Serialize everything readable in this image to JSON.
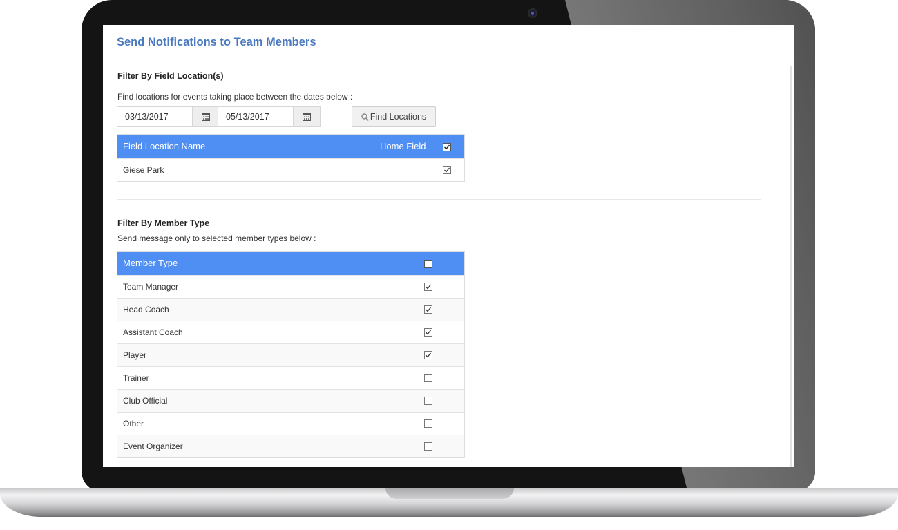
{
  "page": {
    "title": "Send Notifications to Team Members"
  },
  "location_filter": {
    "title": "Filter By Field Location(s)",
    "description": "Find locations for events taking place between the dates below :",
    "start_date": "03/13/2017",
    "end_date": "05/13/2017",
    "date_separator": "-",
    "find_button_label": "Find Locations",
    "table": {
      "col_name": "Field Location Name",
      "col_home": "Home Field",
      "select_all_checked": true,
      "rows": [
        {
          "name": "Giese Park",
          "checked": true
        }
      ]
    }
  },
  "member_filter": {
    "title": "Filter By Member Type",
    "description": "Send message only to selected member types below :",
    "table": {
      "col_type": "Member Type",
      "select_all_checked": false,
      "rows": [
        {
          "name": "Team Manager",
          "checked": true
        },
        {
          "name": "Head Coach",
          "checked": true
        },
        {
          "name": "Assistant Coach",
          "checked": true
        },
        {
          "name": "Player",
          "checked": true
        },
        {
          "name": "Trainer",
          "checked": false
        },
        {
          "name": "Club Official",
          "checked": false
        },
        {
          "name": "Other",
          "checked": false
        },
        {
          "name": "Event Organizer",
          "checked": false
        }
      ]
    }
  },
  "icons": {
    "calendar": "calendar-icon",
    "search": "search-icon",
    "check": "checkmark-icon"
  },
  "colors": {
    "title_blue": "#4a79c0",
    "table_header": "#4f8ef2"
  }
}
